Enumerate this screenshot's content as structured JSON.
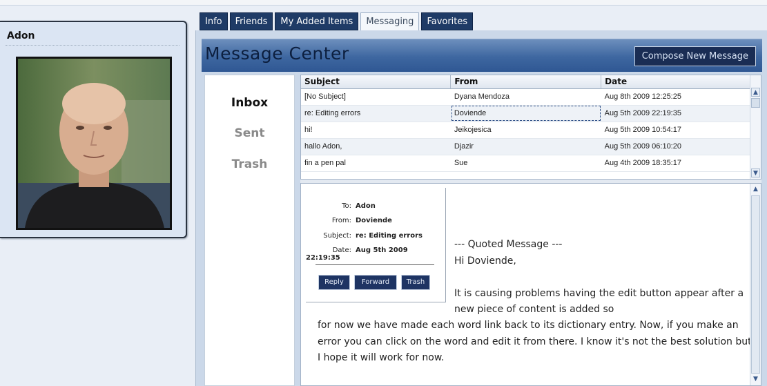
{
  "profile": {
    "name": "Adon"
  },
  "tabs": [
    {
      "label": "Info",
      "active": false
    },
    {
      "label": "Friends",
      "active": false
    },
    {
      "label": "My Added Items",
      "active": false
    },
    {
      "label": "Messaging",
      "active": true
    },
    {
      "label": "Favorites",
      "active": false
    }
  ],
  "header": {
    "title": "Message Center",
    "compose_label": "Compose New Message"
  },
  "folders": [
    "Inbox",
    "Sent",
    "Trash"
  ],
  "message_list": {
    "columns": [
      "Subject",
      "From",
      "Date"
    ],
    "rows": [
      {
        "subject": "[No Subject]",
        "from": "Dyana Mendoza",
        "date": "Aug 8th 2009 12:25:25"
      },
      {
        "subject": "re: Editing errors",
        "from": "Doviende",
        "date": "Aug 5th 2009 22:19:35"
      },
      {
        "subject": "hi!",
        "from": "Jeikojesica",
        "date": "Aug 5th 2009 10:54:17"
      },
      {
        "subject": "hallo Adon,",
        "from": "Djazir",
        "date": "Aug 5th 2009 06:10:20"
      },
      {
        "subject": "fin a pen pal",
        "from": "Sue",
        "date": "Aug 4th 2009 18:35:17"
      }
    ]
  },
  "message": {
    "to_label": "To:",
    "to": "Adon",
    "from_label": "From:",
    "from": "Doviende",
    "subject_label": "Subject:",
    "subject": "re: Editing errors",
    "date_label": "Date:",
    "date": "Aug 5th 2009 22:19:35",
    "reply_label": "Reply",
    "forward_label": "Forward",
    "trash_label": "Trash",
    "quoted_header": "--- Quoted Message ---",
    "greeting": "Hi Doviende,",
    "para_start": "It is causing problems having the edit button appear after a new piece of content is added so",
    "para_rest": "for now we have made each word link back to its dictionary entry. Now, if you make an error you can click on the word and edit it from there. I know it's not the best solution but I hope it will work for now."
  },
  "colors": {
    "tab_bg": "#1f3b66",
    "header_bg": "#3e67a0",
    "button_bg": "#1e3463"
  }
}
